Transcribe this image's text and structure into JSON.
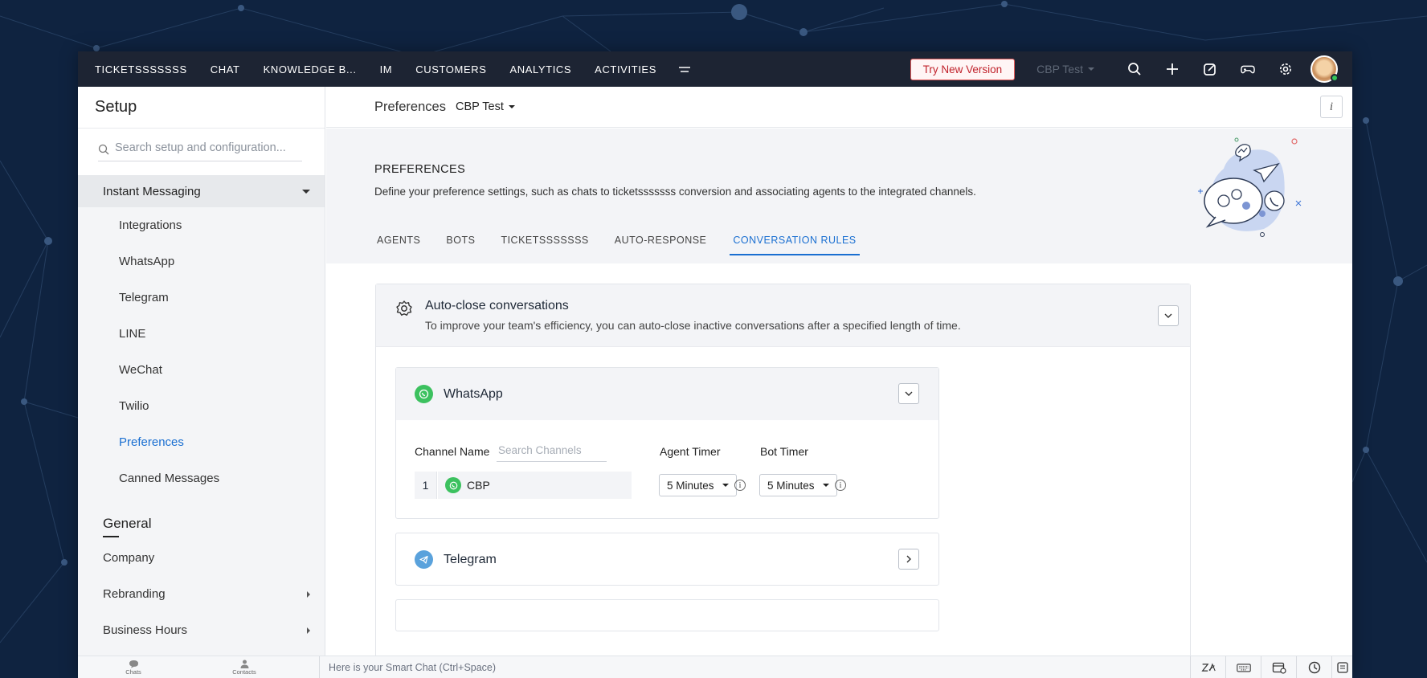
{
  "nav": {
    "items": [
      "TICKETSSSSSSS",
      "CHAT",
      "KNOWLEDGE B...",
      "IM",
      "CUSTOMERS",
      "ANALYTICS",
      "ACTIVITIES"
    ],
    "try_new_version": "Try New Version",
    "department": "CBP Test"
  },
  "sidebar": {
    "title": "Setup",
    "search_placeholder": "Search setup and configuration...",
    "group": "Instant Messaging",
    "sub_items": [
      {
        "label": "Integrations",
        "active": false
      },
      {
        "label": "WhatsApp",
        "active": false
      },
      {
        "label": "Telegram",
        "active": false
      },
      {
        "label": "LINE",
        "active": false
      },
      {
        "label": "WeChat",
        "active": false
      },
      {
        "label": "Twilio",
        "active": false
      },
      {
        "label": "Preferences",
        "active": true
      },
      {
        "label": "Canned Messages",
        "active": false
      }
    ],
    "section": "General",
    "section_items": [
      "Company",
      "Rebranding",
      "Business Hours"
    ]
  },
  "header": {
    "title": "Preferences",
    "department": "CBP Test",
    "info": "i"
  },
  "banner": {
    "title": "PREFERENCES",
    "description": "Define your preference settings, such as chats to ticketsssssss conversion and associating agents to the integrated channels.",
    "tabs": [
      "AGENTS",
      "BOTS",
      "TICKETSSSSSSS",
      "AUTO-RESPONSE",
      "CONVERSATION RULES"
    ],
    "active_tab": "CONVERSATION RULES"
  },
  "rule": {
    "title": "Auto-close conversations",
    "description": "To improve your team's efficiency, you can auto-close inactive conversations after a specified length of time."
  },
  "whatsapp": {
    "name": "WhatsApp",
    "col_channel": "Channel Name",
    "search_placeholder": "Search Channels",
    "col_agent": "Agent Timer",
    "col_bot": "Bot Timer",
    "row_num": "1",
    "row_channel": "CBP",
    "agent_timer": "5 Minutes",
    "bot_timer": "5 Minutes",
    "info": "i"
  },
  "telegram": {
    "name": "Telegram"
  },
  "bottom": {
    "chats": "Chats",
    "contacts": "Contacts",
    "smart_chat": "Here is your Smart Chat (Ctrl+Space)"
  },
  "colors": {
    "nav_bg": "#1d2433",
    "accent": "#1a6fd1",
    "whatsapp": "#3cc15f",
    "telegram": "#5aa2dc",
    "try_btn": "#c0222b"
  }
}
